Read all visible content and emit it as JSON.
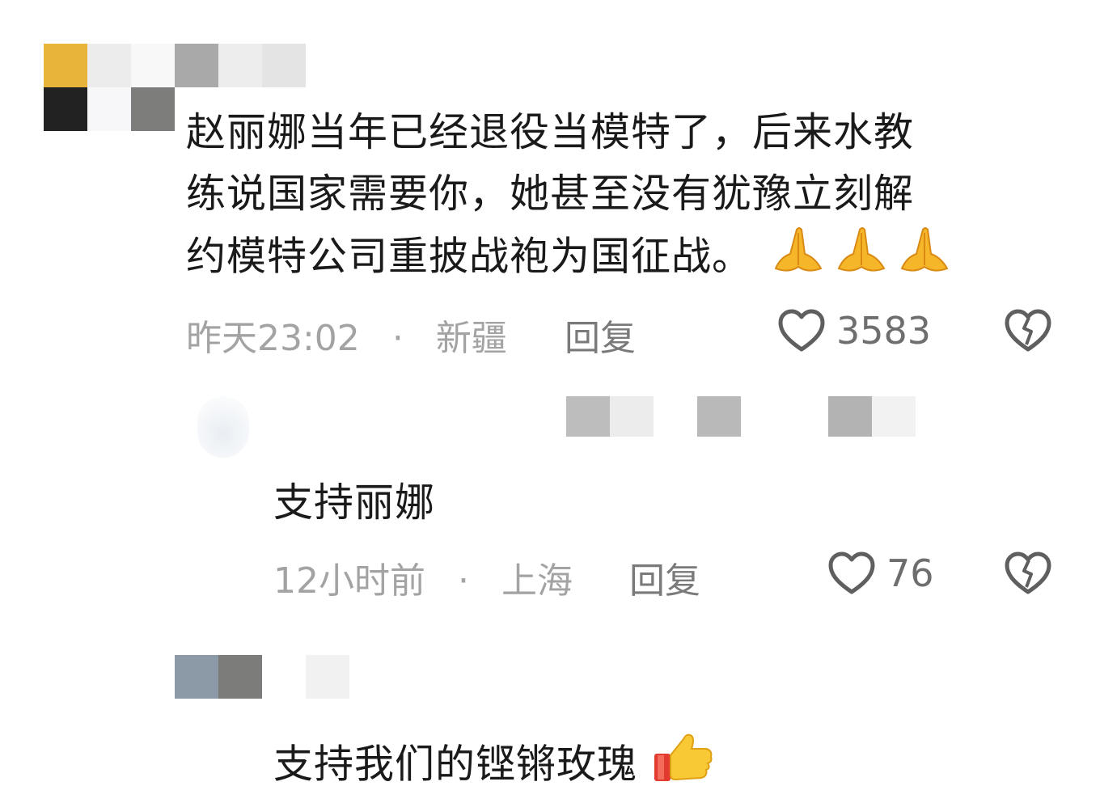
{
  "comments": [
    {
      "text_line1": "赵丽娜当年已经退役当模特了，后来水教",
      "text_line2": "练说国家需要你，她甚至没有犹豫立刻解",
      "text_line3": "约模特公司重披战袍为国征战。",
      "emoji": "folded-hands x3",
      "time": "昨天23:02",
      "separator": "·",
      "location": "新疆",
      "reply_label": "回复",
      "like_count": "3583"
    },
    {
      "text": "支持丽娜",
      "time": "12小时前",
      "separator": "·",
      "location": "上海",
      "reply_label": "回复",
      "like_count": "76"
    },
    {
      "text": "支持我们的铿锵玫瑰",
      "emoji": "thumbs-up"
    }
  ],
  "icons": {
    "like": "heart-outline-icon",
    "dislike": "broken-heart-icon"
  }
}
